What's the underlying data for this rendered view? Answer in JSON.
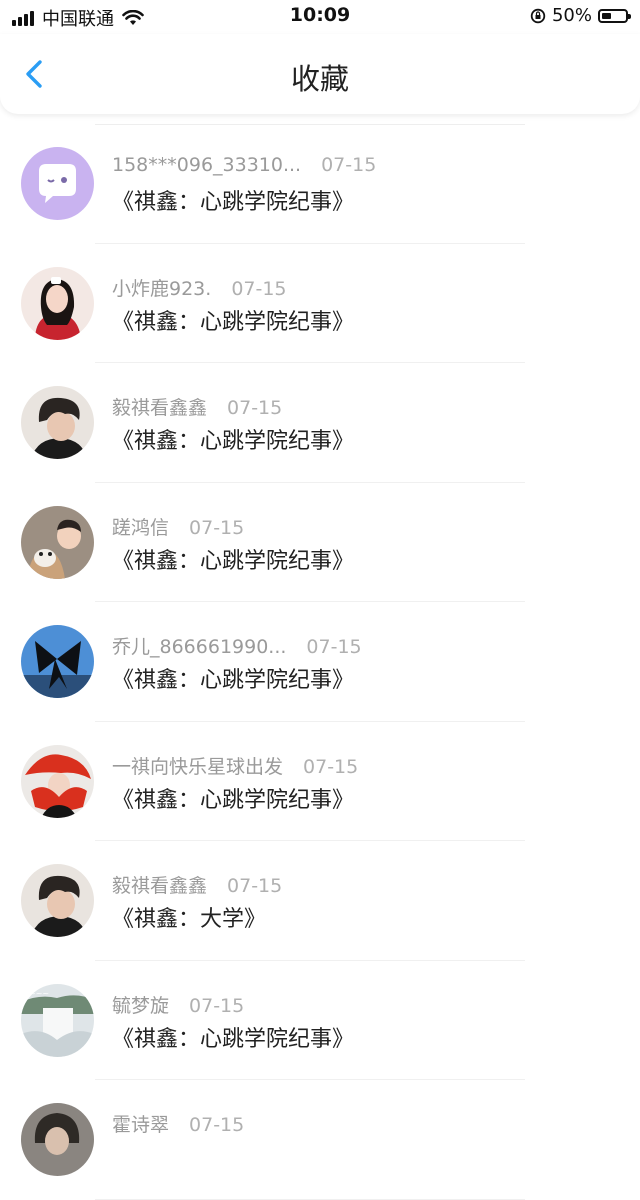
{
  "status_bar": {
    "carrier": "中国联通",
    "time": "10:09",
    "battery": "50%",
    "battery_level": 0.5
  },
  "nav": {
    "title": "收藏"
  },
  "favorites": [
    {
      "name": "158***096_33310...",
      "date": "07-15",
      "title": "《祺鑫：心跳学院纪事》",
      "avatar": "wechat-default-avatar"
    },
    {
      "name": "小炸鹿923.",
      "date": "07-15",
      "title": "《祺鑫：心跳学院纪事》",
      "avatar": "girl-photo-avatar"
    },
    {
      "name": "毅祺看鑫鑫",
      "date": "07-15",
      "title": "《祺鑫：心跳学院纪事》",
      "avatar": "boy-photo-avatar"
    },
    {
      "name": "蹉鸿信",
      "date": "07-15",
      "title": "《祺鑫：心跳学院纪事》",
      "avatar": "child-dog-avatar"
    },
    {
      "name": "乔儿_866661990...",
      "date": "07-15",
      "title": "《祺鑫：心跳学院纪事》",
      "avatar": "sky-bow-avatar"
    },
    {
      "name": "一祺向快乐星球出发",
      "date": "07-15",
      "title": "《祺鑫：心跳学院纪事》",
      "avatar": "red-scarf-avatar"
    },
    {
      "name": "毅祺看鑫鑫",
      "date": "07-15",
      "title": "《祺鑫：大学》",
      "avatar": "boy-photo-avatar"
    },
    {
      "name": "毓梦旋",
      "date": "07-15",
      "title": "《祺鑫：心跳学院纪事》",
      "avatar": "waterfall-avatar"
    },
    {
      "name": "霍诗翠",
      "date": "07-15",
      "title": "",
      "avatar": "portrait-avatar"
    }
  ]
}
